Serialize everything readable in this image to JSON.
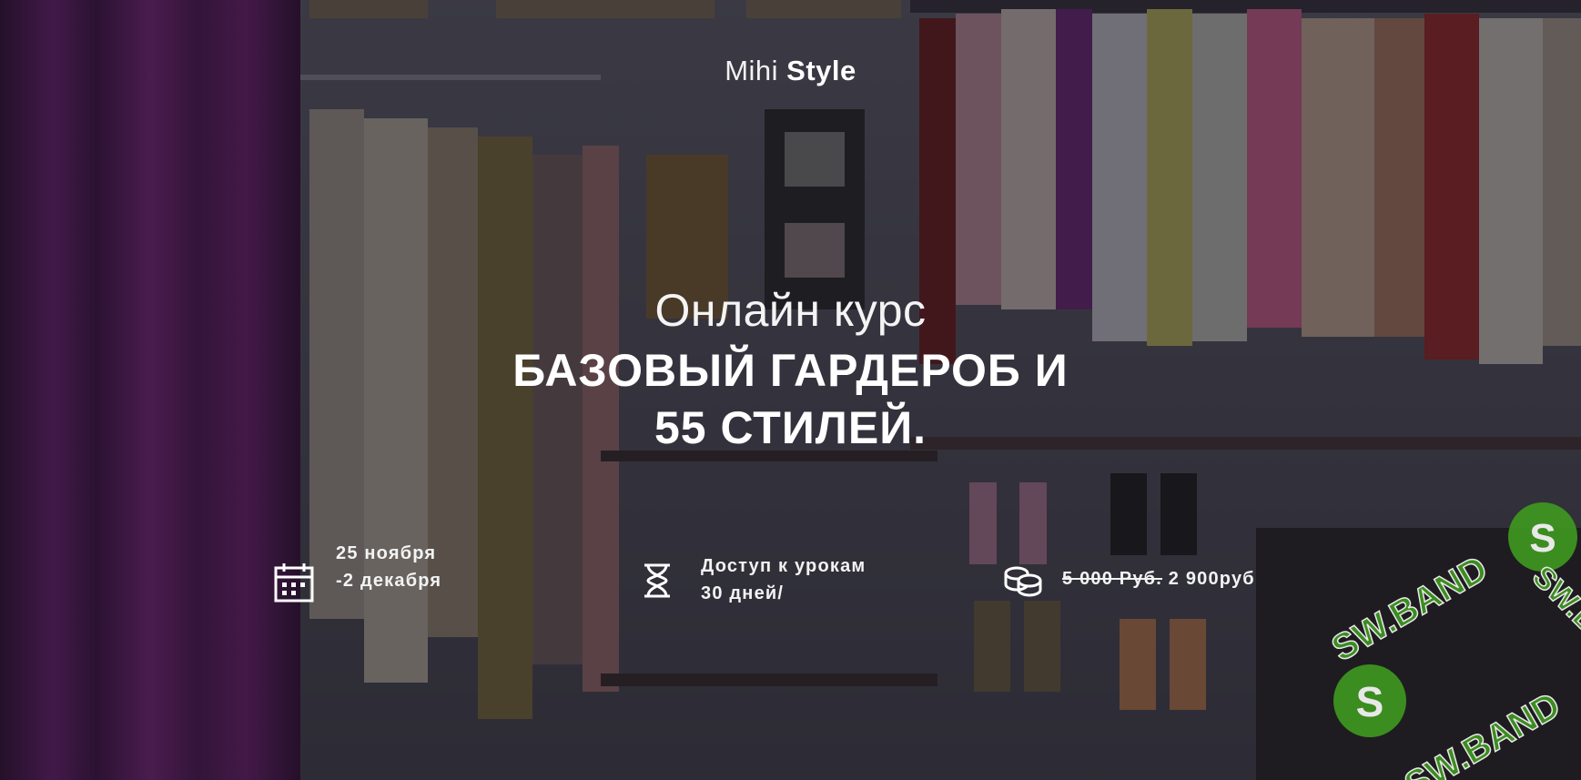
{
  "logo": {
    "part1": "Mihi",
    "part2": "Style"
  },
  "hero": {
    "subtitle": "Онлайн курс",
    "title_line1": "БАЗОВЫЙ ГАРДЕРОБ И",
    "title_line2": "55 СТИЛЕЙ."
  },
  "info": {
    "dates": {
      "icon": "calendar-icon",
      "line1": "25 ноября",
      "line2": "-2 декабря"
    },
    "access": {
      "icon": "hourglass-icon",
      "line1": "Доступ к урокам",
      "line2": "30 дней/"
    },
    "price": {
      "icon": "coins-icon",
      "old": "5 000 Руб.",
      "new": "2 900руб"
    }
  },
  "watermark": {
    "text": "SW.BAND"
  },
  "colors": {
    "overlay": "#14121a",
    "text": "#ffffff",
    "curtain": "#6a1d72",
    "watermark": "#3f9a1f"
  }
}
